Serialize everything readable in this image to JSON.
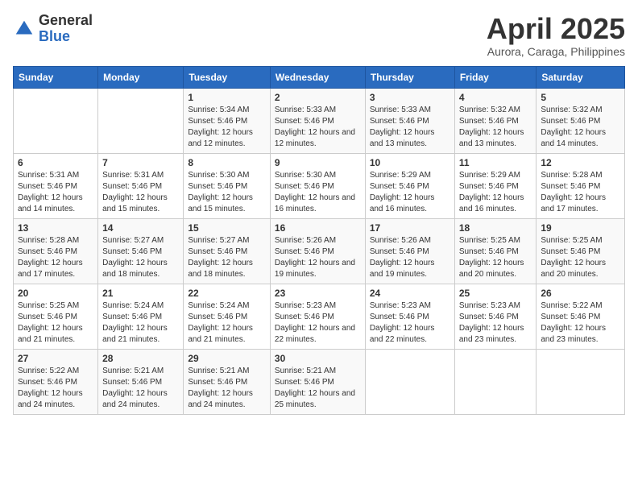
{
  "logo": {
    "general": "General",
    "blue": "Blue"
  },
  "header": {
    "title": "April 2025",
    "subtitle": "Aurora, Caraga, Philippines"
  },
  "days_of_week": [
    "Sunday",
    "Monday",
    "Tuesday",
    "Wednesday",
    "Thursday",
    "Friday",
    "Saturday"
  ],
  "weeks": [
    [
      {
        "day": "",
        "sunrise": "",
        "sunset": "",
        "daylight": ""
      },
      {
        "day": "",
        "sunrise": "",
        "sunset": "",
        "daylight": ""
      },
      {
        "day": "1",
        "sunrise": "Sunrise: 5:34 AM",
        "sunset": "Sunset: 5:46 PM",
        "daylight": "Daylight: 12 hours and 12 minutes."
      },
      {
        "day": "2",
        "sunrise": "Sunrise: 5:33 AM",
        "sunset": "Sunset: 5:46 PM",
        "daylight": "Daylight: 12 hours and 12 minutes."
      },
      {
        "day": "3",
        "sunrise": "Sunrise: 5:33 AM",
        "sunset": "Sunset: 5:46 PM",
        "daylight": "Daylight: 12 hours and 13 minutes."
      },
      {
        "day": "4",
        "sunrise": "Sunrise: 5:32 AM",
        "sunset": "Sunset: 5:46 PM",
        "daylight": "Daylight: 12 hours and 13 minutes."
      },
      {
        "day": "5",
        "sunrise": "Sunrise: 5:32 AM",
        "sunset": "Sunset: 5:46 PM",
        "daylight": "Daylight: 12 hours and 14 minutes."
      }
    ],
    [
      {
        "day": "6",
        "sunrise": "Sunrise: 5:31 AM",
        "sunset": "Sunset: 5:46 PM",
        "daylight": "Daylight: 12 hours and 14 minutes."
      },
      {
        "day": "7",
        "sunrise": "Sunrise: 5:31 AM",
        "sunset": "Sunset: 5:46 PM",
        "daylight": "Daylight: 12 hours and 15 minutes."
      },
      {
        "day": "8",
        "sunrise": "Sunrise: 5:30 AM",
        "sunset": "Sunset: 5:46 PM",
        "daylight": "Daylight: 12 hours and 15 minutes."
      },
      {
        "day": "9",
        "sunrise": "Sunrise: 5:30 AM",
        "sunset": "Sunset: 5:46 PM",
        "daylight": "Daylight: 12 hours and 16 minutes."
      },
      {
        "day": "10",
        "sunrise": "Sunrise: 5:29 AM",
        "sunset": "Sunset: 5:46 PM",
        "daylight": "Daylight: 12 hours and 16 minutes."
      },
      {
        "day": "11",
        "sunrise": "Sunrise: 5:29 AM",
        "sunset": "Sunset: 5:46 PM",
        "daylight": "Daylight: 12 hours and 16 minutes."
      },
      {
        "day": "12",
        "sunrise": "Sunrise: 5:28 AM",
        "sunset": "Sunset: 5:46 PM",
        "daylight": "Daylight: 12 hours and 17 minutes."
      }
    ],
    [
      {
        "day": "13",
        "sunrise": "Sunrise: 5:28 AM",
        "sunset": "Sunset: 5:46 PM",
        "daylight": "Daylight: 12 hours and 17 minutes."
      },
      {
        "day": "14",
        "sunrise": "Sunrise: 5:27 AM",
        "sunset": "Sunset: 5:46 PM",
        "daylight": "Daylight: 12 hours and 18 minutes."
      },
      {
        "day": "15",
        "sunrise": "Sunrise: 5:27 AM",
        "sunset": "Sunset: 5:46 PM",
        "daylight": "Daylight: 12 hours and 18 minutes."
      },
      {
        "day": "16",
        "sunrise": "Sunrise: 5:26 AM",
        "sunset": "Sunset: 5:46 PM",
        "daylight": "Daylight: 12 hours and 19 minutes."
      },
      {
        "day": "17",
        "sunrise": "Sunrise: 5:26 AM",
        "sunset": "Sunset: 5:46 PM",
        "daylight": "Daylight: 12 hours and 19 minutes."
      },
      {
        "day": "18",
        "sunrise": "Sunrise: 5:25 AM",
        "sunset": "Sunset: 5:46 PM",
        "daylight": "Daylight: 12 hours and 20 minutes."
      },
      {
        "day": "19",
        "sunrise": "Sunrise: 5:25 AM",
        "sunset": "Sunset: 5:46 PM",
        "daylight": "Daylight: 12 hours and 20 minutes."
      }
    ],
    [
      {
        "day": "20",
        "sunrise": "Sunrise: 5:25 AM",
        "sunset": "Sunset: 5:46 PM",
        "daylight": "Daylight: 12 hours and 21 minutes."
      },
      {
        "day": "21",
        "sunrise": "Sunrise: 5:24 AM",
        "sunset": "Sunset: 5:46 PM",
        "daylight": "Daylight: 12 hours and 21 minutes."
      },
      {
        "day": "22",
        "sunrise": "Sunrise: 5:24 AM",
        "sunset": "Sunset: 5:46 PM",
        "daylight": "Daylight: 12 hours and 21 minutes."
      },
      {
        "day": "23",
        "sunrise": "Sunrise: 5:23 AM",
        "sunset": "Sunset: 5:46 PM",
        "daylight": "Daylight: 12 hours and 22 minutes."
      },
      {
        "day": "24",
        "sunrise": "Sunrise: 5:23 AM",
        "sunset": "Sunset: 5:46 PM",
        "daylight": "Daylight: 12 hours and 22 minutes."
      },
      {
        "day": "25",
        "sunrise": "Sunrise: 5:23 AM",
        "sunset": "Sunset: 5:46 PM",
        "daylight": "Daylight: 12 hours and 23 minutes."
      },
      {
        "day": "26",
        "sunrise": "Sunrise: 5:22 AM",
        "sunset": "Sunset: 5:46 PM",
        "daylight": "Daylight: 12 hours and 23 minutes."
      }
    ],
    [
      {
        "day": "27",
        "sunrise": "Sunrise: 5:22 AM",
        "sunset": "Sunset: 5:46 PM",
        "daylight": "Daylight: 12 hours and 24 minutes."
      },
      {
        "day": "28",
        "sunrise": "Sunrise: 5:21 AM",
        "sunset": "Sunset: 5:46 PM",
        "daylight": "Daylight: 12 hours and 24 minutes."
      },
      {
        "day": "29",
        "sunrise": "Sunrise: 5:21 AM",
        "sunset": "Sunset: 5:46 PM",
        "daylight": "Daylight: 12 hours and 24 minutes."
      },
      {
        "day": "30",
        "sunrise": "Sunrise: 5:21 AM",
        "sunset": "Sunset: 5:46 PM",
        "daylight": "Daylight: 12 hours and 25 minutes."
      },
      {
        "day": "",
        "sunrise": "",
        "sunset": "",
        "daylight": ""
      },
      {
        "day": "",
        "sunrise": "",
        "sunset": "",
        "daylight": ""
      },
      {
        "day": "",
        "sunrise": "",
        "sunset": "",
        "daylight": ""
      }
    ]
  ]
}
